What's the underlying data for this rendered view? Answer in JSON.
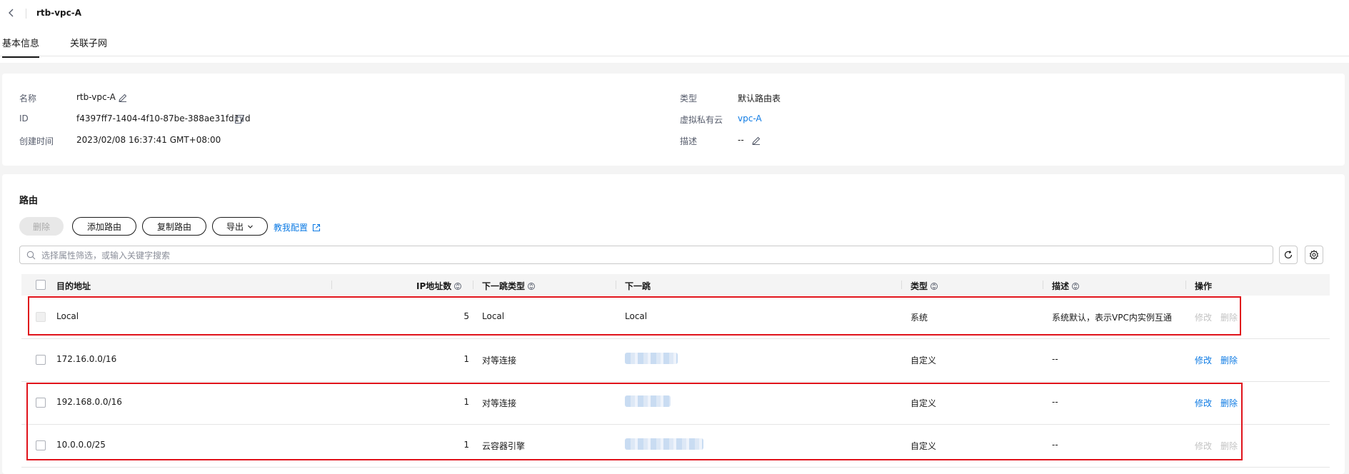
{
  "header": {
    "title": "rtb-vpc-A",
    "tabs": [
      {
        "label": "基本信息",
        "active": true
      },
      {
        "label": "关联子网",
        "active": false
      }
    ]
  },
  "info": {
    "name_label": "名称",
    "name_value": "rtb-vpc-A",
    "id_label": "ID",
    "id_value": "f4397ff7-1404-4f10-87be-388ae31fd17d",
    "created_label": "创建时间",
    "created_value": "2023/02/08 16:37:41 GMT+08:00",
    "type_label": "类型",
    "type_value": "默认路由表",
    "vpc_label": "虚拟私有云",
    "vpc_value": "vpc-A",
    "desc_label": "描述",
    "desc_value": "--"
  },
  "routes": {
    "title": "路由",
    "toolbar": {
      "delete": "删除",
      "add": "添加路由",
      "copy": "复制路由",
      "export": "导出",
      "help": "教我配置"
    },
    "search_placeholder": "选择属性筛选，或输入关键字搜索",
    "columns": {
      "dest": "目的地址",
      "ip_count": "IP地址数",
      "next_hop_type": "下一跳类型",
      "next_hop": "下一跳",
      "type": "类型",
      "desc": "描述",
      "ops": "操作"
    },
    "rows": [
      {
        "dest": "Local",
        "ip_count": "5",
        "next_hop_type": "Local",
        "next_hop": "Local",
        "type": "系统",
        "desc": "系统默认，表示VPC内实例互通",
        "modify": "修改",
        "delete": "删除",
        "editable": false
      },
      {
        "dest": "172.16.0.0/16",
        "ip_count": "1",
        "next_hop_type": "对等连接",
        "next_hop": "",
        "type": "自定义",
        "desc": "--",
        "modify": "修改",
        "delete": "删除",
        "editable": true
      },
      {
        "dest": "192.168.0.0/16",
        "ip_count": "1",
        "next_hop_type": "对等连接",
        "next_hop": "",
        "type": "自定义",
        "desc": "--",
        "modify": "修改",
        "delete": "删除",
        "editable": true
      },
      {
        "dest": "10.0.0.0/25",
        "ip_count": "1",
        "next_hop_type": "云容器引擎",
        "next_hop": "",
        "type": "自定义",
        "desc": "--",
        "modify": "修改",
        "delete": "删除",
        "editable": false
      }
    ]
  },
  "colors": {
    "link": "#0e7be4",
    "highlight": "#e0131b"
  }
}
